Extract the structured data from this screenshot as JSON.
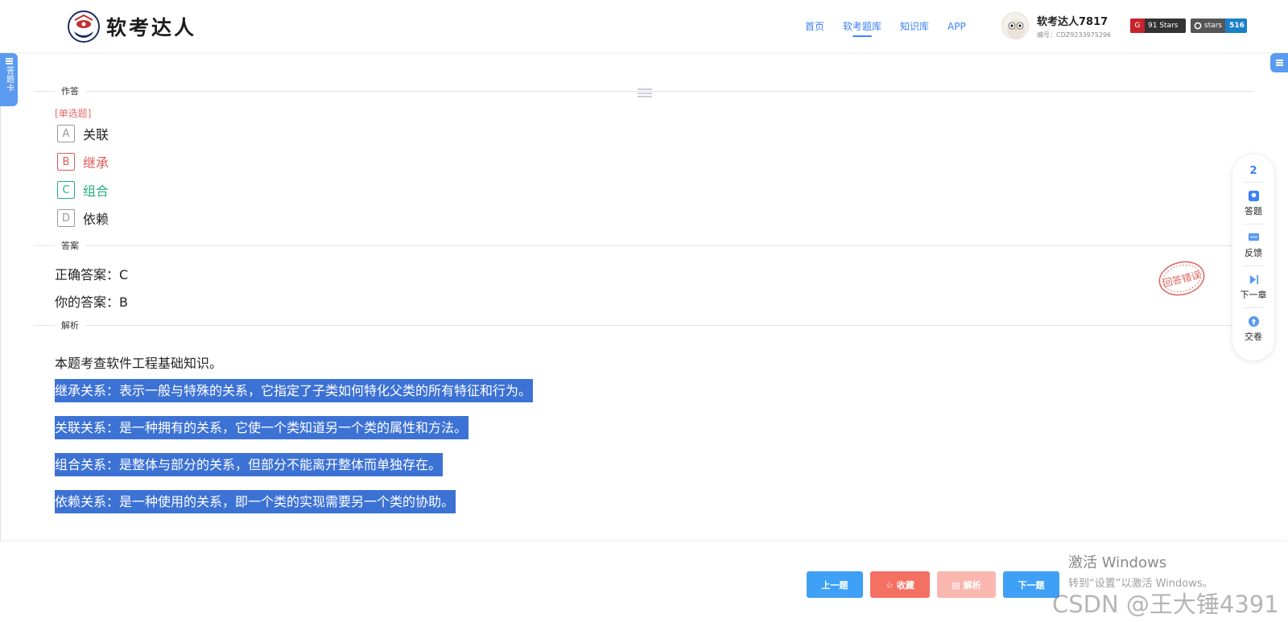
{
  "header": {
    "logo_text": "软考达人",
    "nav": [
      {
        "label": "首页",
        "active": false
      },
      {
        "label": "软考题库",
        "active": true
      },
      {
        "label": "知识库",
        "active": false
      },
      {
        "label": "APP",
        "active": false
      }
    ],
    "user": {
      "name": "软考达人7817",
      "id": "编号：CDZ9233975296"
    },
    "badges": {
      "stars_label": "91 Stars",
      "gh_label": "stars",
      "gh_count": "516"
    }
  },
  "side": {
    "answer_card": "答题卡"
  },
  "sections": {
    "answer_area": "作答",
    "answer": "答案",
    "analysis": "解析"
  },
  "question": {
    "type": "[单选题]",
    "options": [
      {
        "letter": "A",
        "text": "关联",
        "state": "normal"
      },
      {
        "letter": "B",
        "text": "继承",
        "state": "wrong"
      },
      {
        "letter": "C",
        "text": "组合",
        "state": "right"
      },
      {
        "letter": "D",
        "text": "依赖",
        "state": "normal"
      }
    ],
    "correct_answer": "正确答案：C",
    "your_answer": "你的答案：B",
    "stamp": "回答错误"
  },
  "analysis": {
    "intro": "本题考查软件工程基础知识。",
    "points": [
      "继承关系：表示一般与特殊的关系，它指定了子类如何特化父类的所有特征和行为。",
      "关联关系：是一种拥有的关系，它使一个类知道另一个类的属性和方法。",
      "组合关系：是整体与部分的关系，但部分不能离开整体而单独存在。",
      "依赖关系：是一种使用的关系，即一个类的实现需要另一个类的协助。"
    ]
  },
  "float_bar": {
    "count": "2",
    "items": [
      {
        "label": "答题",
        "icon": "answer-icon"
      },
      {
        "label": "反馈",
        "icon": "feedback-icon"
      },
      {
        "label": "下一章",
        "icon": "next-chapter-icon"
      },
      {
        "label": "交卷",
        "icon": "submit-icon"
      }
    ]
  },
  "bottom": {
    "prev": "上一题",
    "fav": "☆ 收藏",
    "analysis": "▤ 解析",
    "next": "下一题"
  },
  "watermark": {
    "line1": "激活 Windows",
    "line2": "转到“设置”以激活 Windows。",
    "csdn": "CSDN @王大锤4391"
  },
  "colors": {
    "accent": "#3a82f6",
    "wrong": "#e05a5a",
    "right": "#25b07a",
    "highlight": "#3d72d5"
  }
}
